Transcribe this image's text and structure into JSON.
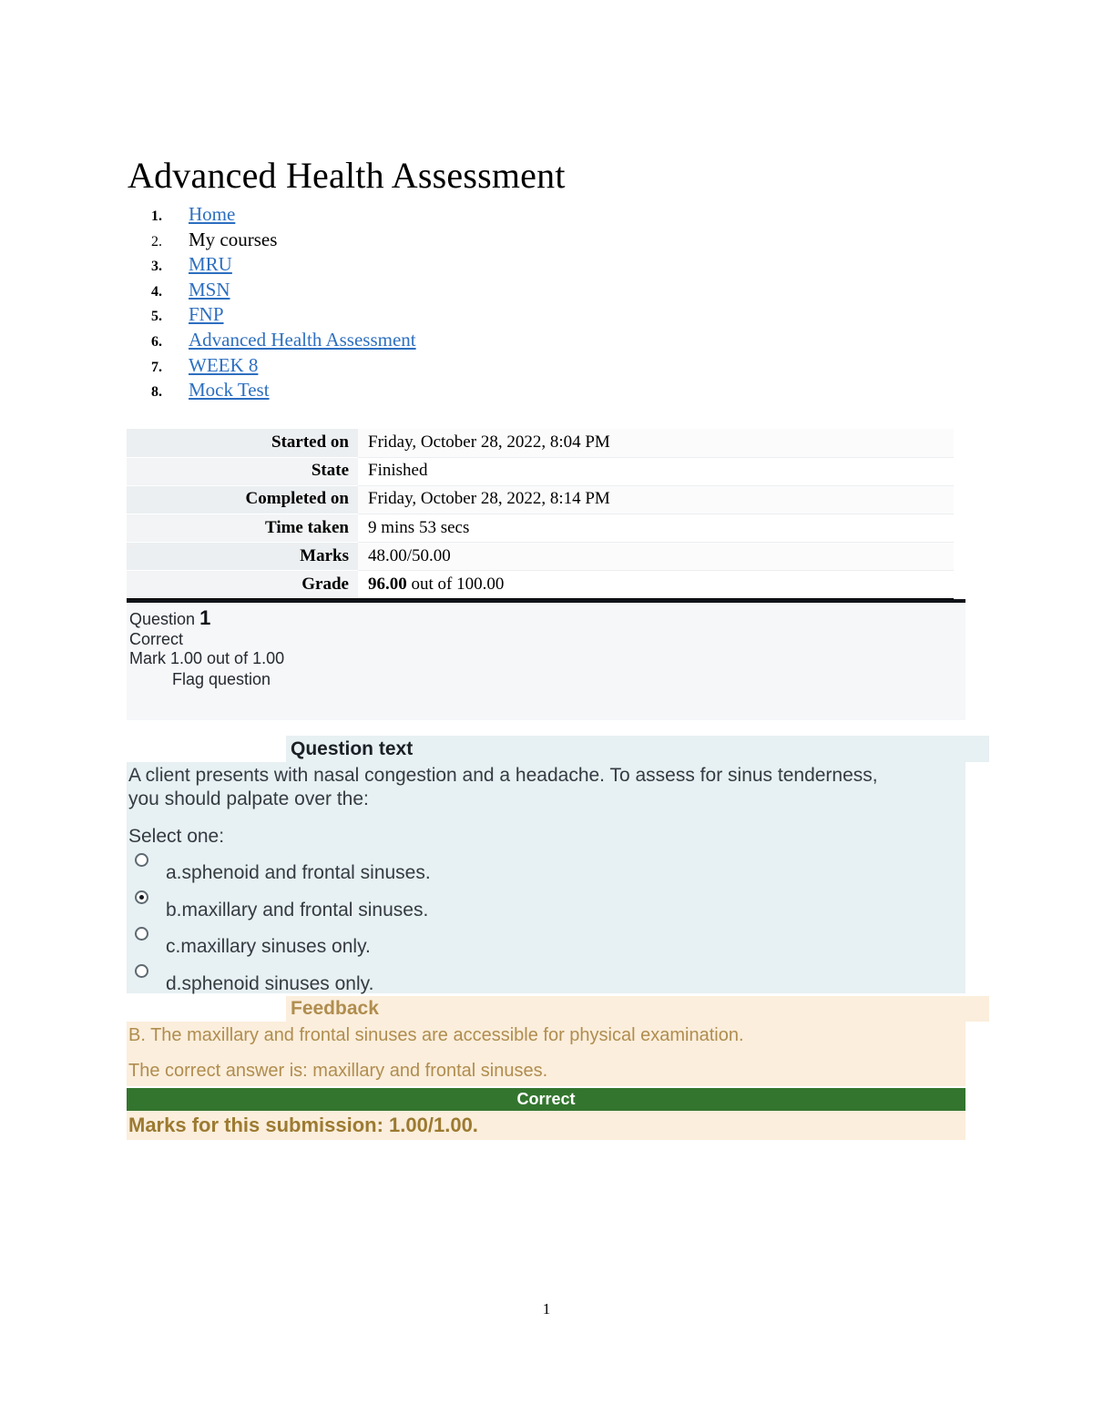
{
  "document": {
    "title": "Advanced Health Assessment",
    "page_number": "1"
  },
  "breadcrumb": {
    "items": [
      {
        "number": "1.",
        "label": "Home",
        "is_link": true
      },
      {
        "number": "2.",
        "label": "My courses",
        "is_link": false
      },
      {
        "number": "3.",
        "label": "MRU",
        "is_link": true
      },
      {
        "number": "4.",
        "label": "MSN",
        "is_link": true
      },
      {
        "number": "5.",
        "label": "FNP",
        "is_link": true
      },
      {
        "number": "6.",
        "label": "Advanced Health Assessment",
        "is_link": true
      },
      {
        "number": "7.",
        "label": "WEEK 8",
        "is_link": true
      },
      {
        "number": "8.",
        "label": "Mock Test",
        "is_link": true
      }
    ]
  },
  "attempt_summary": {
    "rows": [
      {
        "label": "Started on",
        "value": "Friday, October 28, 2022, 8:04 PM"
      },
      {
        "label": "State",
        "value": "Finished"
      },
      {
        "label": "Completed on",
        "value": "Friday, October 28, 2022, 8:14 PM"
      },
      {
        "label": "Time taken",
        "value": "9 mins 53 secs"
      },
      {
        "label": "Marks",
        "value": "48.00/50.00"
      },
      {
        "label": "Grade",
        "value_bold": "96.00",
        "value_rest": " out of 100.00"
      }
    ]
  },
  "question": {
    "number_label": "Question",
    "number": "1",
    "status": "Correct",
    "mark": "Mark 1.00 out of 1.00",
    "flag_label": "Flag question",
    "question_text_heading": "Question text",
    "stem": "A client presents with nasal congestion and a headache. To assess for sinus tenderness, you should palpate over the:",
    "select_prompt": "Select one:",
    "options": [
      {
        "letter": "a.",
        "text": "sphenoid and frontal sinuses.",
        "selected": false
      },
      {
        "letter": "b.",
        "text": "maxillary and frontal sinuses.",
        "selected": true
      },
      {
        "letter": "c.",
        "text": "maxillary sinuses only.",
        "selected": false
      },
      {
        "letter": "d.",
        "text": "sphenoid sinuses only.",
        "selected": false
      }
    ],
    "feedback": {
      "heading": "Feedback",
      "line1": "B.  The maxillary and  frontal sinuses are accessible for physical examination.",
      "line2": "The correct answer is: maxillary and frontal sinuses.",
      "correct_banner": "Correct",
      "marks_line": "Marks for this submission: 1.00/1.00."
    }
  },
  "colors": {
    "link": "#2d6fc0",
    "question_bg": "#e7f0f2",
    "feedback_bg": "#fbeedc",
    "feedback_text": "#b08d4f",
    "correct_green": "#33752e",
    "marks_text": "#9c7a31"
  }
}
